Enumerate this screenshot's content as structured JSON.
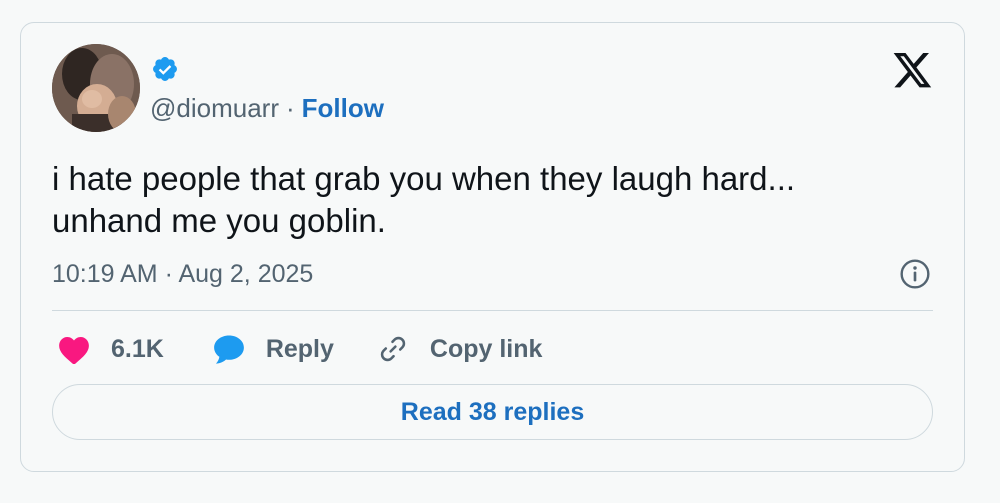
{
  "tweet": {
    "handle": "@diomuarr",
    "separator": "·",
    "follow_label": "Follow",
    "text_lines": [
      "i hate people that grab you when they laugh hard...",
      "unhand me you goblin."
    ],
    "timestamp": "10:19 AM · Aug 2, 2025"
  },
  "actions": {
    "like_count": "6.1K",
    "reply_label": "Reply",
    "copy_label": "Copy link"
  },
  "read_replies_label": "Read 38 replies",
  "icons": {
    "verified": "verified-badge-icon",
    "x_logo": "x-logo-icon",
    "info": "info-icon",
    "like": "heart-icon",
    "reply": "speech-bubble-icon",
    "copy": "link-icon"
  },
  "colors": {
    "background": "#f7f9f9",
    "border": "#cfd9de",
    "text_primary": "#0f1419",
    "text_secondary": "#536471",
    "link_blue": "#1d6fbf",
    "verified_blue": "#1d9bf0",
    "like_pink": "#f91880",
    "reply_blue": "#1d9bf0"
  }
}
